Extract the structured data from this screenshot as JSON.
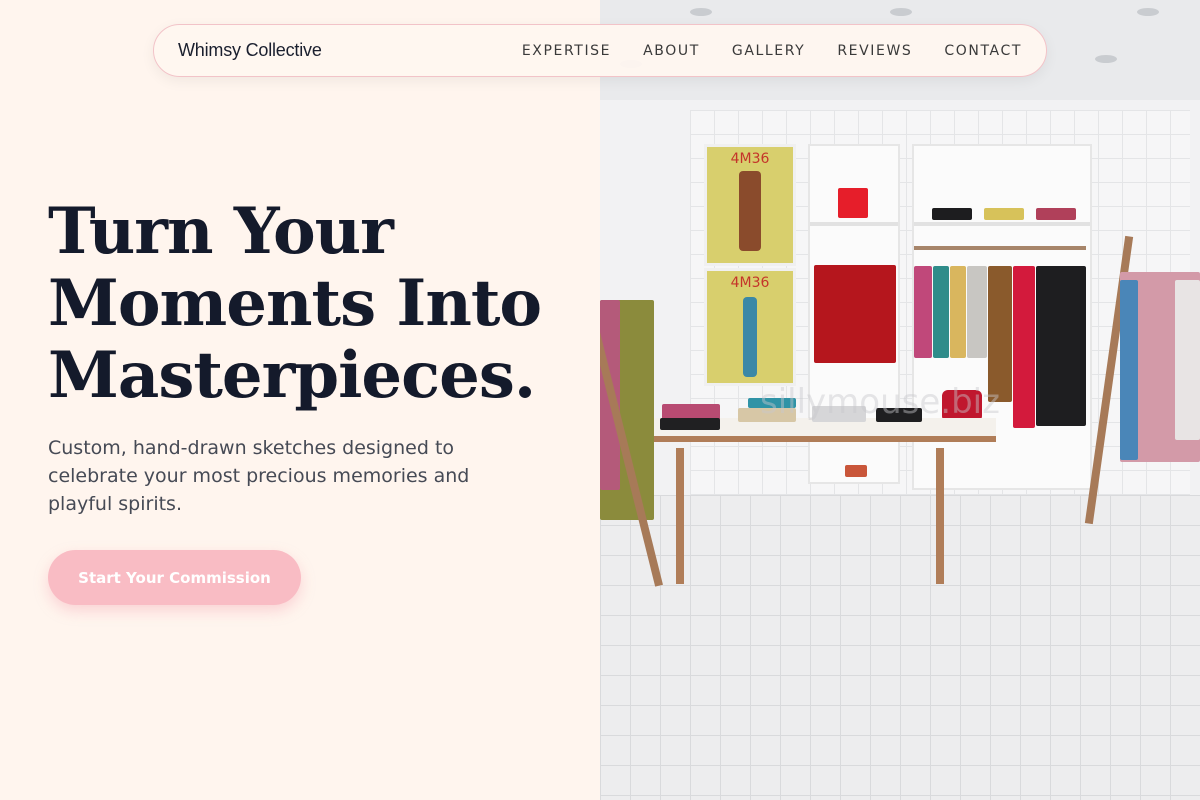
{
  "brand": "Whimsy Collective",
  "nav": [
    "EXPERTISE",
    "ABOUT",
    "GALLERY",
    "REVIEWS",
    "CONTACT"
  ],
  "hero": {
    "title_line1": "Turn Your",
    "title_line2": "Moments Into",
    "title_line3": "Masterpieces.",
    "subtitle": "Custom, hand-drawn sketches designed to celebrate your most precious memories and playful spirits.",
    "cta": "Start Your Commission"
  },
  "image": {
    "poster_top": "4M36",
    "poster_bottom": "4M36",
    "watermark": "sillymouse.biz"
  },
  "colors": {
    "background": "#fff5ee",
    "accent": "#f9bcc4",
    "heading": "#141a2b"
  }
}
